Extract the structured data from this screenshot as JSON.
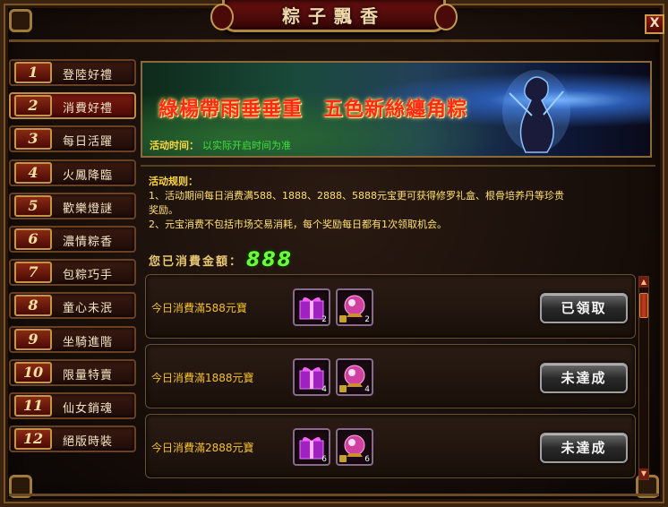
{
  "window": {
    "title": "粽子飄香",
    "close_label": "X"
  },
  "sidebar": {
    "items": [
      {
        "num": "1",
        "label": "登陸好禮",
        "active": false
      },
      {
        "num": "2",
        "label": "消費好禮",
        "active": true
      },
      {
        "num": "3",
        "label": "每日活躍",
        "active": false
      },
      {
        "num": "4",
        "label": "火鳳降臨",
        "active": false
      },
      {
        "num": "5",
        "label": "歡樂燈謎",
        "active": false
      },
      {
        "num": "6",
        "label": "濃情粽香",
        "active": false
      },
      {
        "num": "7",
        "label": "包粽巧手",
        "active": false
      },
      {
        "num": "8",
        "label": "童心未泯",
        "active": false
      },
      {
        "num": "9",
        "label": "坐騎進階",
        "active": false
      },
      {
        "num": "10",
        "label": "限量特賣",
        "active": false
      },
      {
        "num": "11",
        "label": "仙女銷魂",
        "active": false
      },
      {
        "num": "12",
        "label": "絕版時裝",
        "active": false
      }
    ]
  },
  "banner": {
    "title": "綠楊帶雨垂垂重　五色新絲纏角粽",
    "time_label": "活动时间：",
    "time_value": "以实际开启时间为准"
  },
  "rules": {
    "title": "活动规则：",
    "line1": "1、活动期间每日消费满588、1888、2888、5888元宝更可获得修罗礼盒、根骨培养丹等珍贵",
    "line1b": "奖励。",
    "line2": "2、元宝消费不包括市场交易消耗，每个奖励每日都有1次领取机会。"
  },
  "spent": {
    "label": "您已消費金額：",
    "value": "888"
  },
  "rewards": [
    {
      "label": "今日消費滿588元寶",
      "item1_count": "2",
      "item2_count": "2",
      "button": "已領取"
    },
    {
      "label": "今日消費滿1888元寶",
      "item1_count": "4",
      "item2_count": "4",
      "button": "未達成"
    },
    {
      "label": "今日消費滿2888元寶",
      "item1_count": "6",
      "item2_count": "6",
      "button": "未達成"
    }
  ],
  "icons": {
    "gift_box": "purple-gift-box-icon",
    "orb": "pink-spirit-orb-icon",
    "lock": "bound-lock-icon"
  },
  "colors": {
    "accent_gold": "#ffd840",
    "spent_green": "#6aff3a",
    "active_tab": "#7a1a10"
  }
}
